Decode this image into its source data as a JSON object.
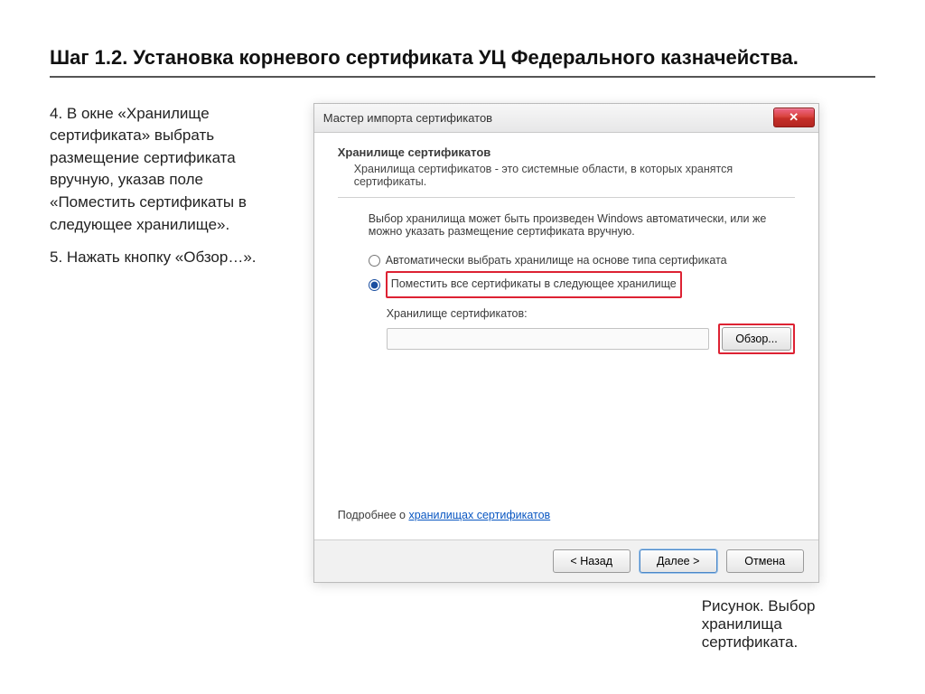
{
  "heading": "Шаг 1.2. Установка корневого сертификата УЦ Федерального казначейства.",
  "instructions": {
    "p1": "4. В окне «Хранилище сертификата» выбрать размещение сертификата вручную, указав поле «Поместить сертификаты в следующее хранилище».",
    "p2": "5. Нажать кнопку «Обзор…»."
  },
  "dialog": {
    "title": "Мастер импорта сертификатов",
    "close_glyph": "✕",
    "section_title": "Хранилище сертификатов",
    "section_desc": "Хранилища сертификатов - это системные области, в которых хранятся сертификаты.",
    "body_text": "Выбор хранилища может быть произведен Windows автоматически, или же можно указать размещение сертификата вручную.",
    "radio_auto": "Автоматически выбрать хранилище на основе типа сертификата",
    "radio_manual": "Поместить все сертификаты в следующее хранилище",
    "store_label": "Хранилище сертификатов:",
    "browse": "Обзор...",
    "learn_prefix": "Подробнее о ",
    "learn_link": "хранилищах сертификатов",
    "back": "< Назад",
    "next": "Далее >",
    "cancel": "Отмена"
  },
  "caption": "Рисунок. Выбор хранилища сертификата."
}
